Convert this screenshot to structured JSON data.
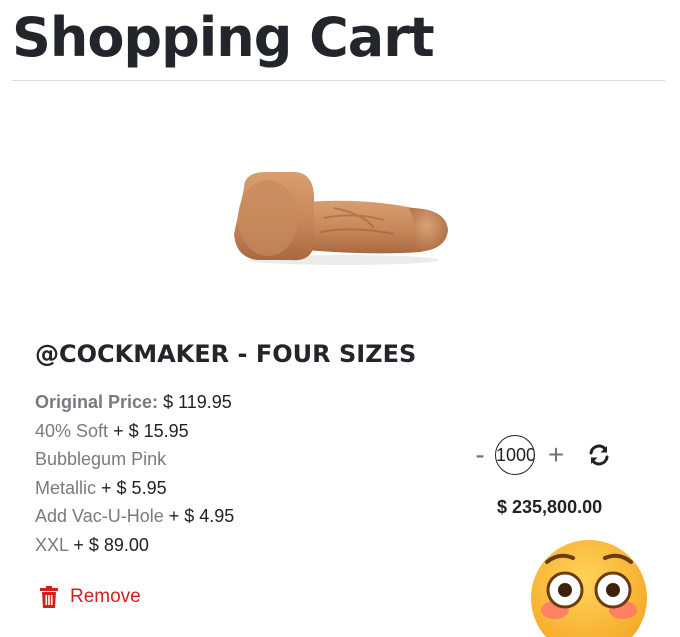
{
  "page": {
    "title": "Shopping Cart"
  },
  "item": {
    "name": "@COCKMAKER - FOUR SIZES",
    "options": [
      {
        "label": "Original Price:",
        "price": "$ 119.95"
      },
      {
        "label": "40% Soft",
        "price": "+ $ 15.95"
      },
      {
        "label": "Bubblegum Pink",
        "price": ""
      },
      {
        "label": "Metallic",
        "price": "+ $ 5.95"
      },
      {
        "label": "Add Vac-U-Hole",
        "price": "+ $ 4.95"
      },
      {
        "label": "XXL",
        "price": "+ $ 89.00"
      }
    ],
    "quantity": "1000",
    "quantity_decrement_label": "-",
    "quantity_increment_label": "+",
    "line_total": "$ 235,800.00",
    "remove_label": "Remove"
  },
  "icons": {
    "refresh": "refresh-icon",
    "trash": "trash-icon",
    "emoji": "flushed-face-emoji"
  },
  "colors": {
    "remove": "#d31f1f",
    "title": "#22262b",
    "muted_label": "#777b80"
  }
}
